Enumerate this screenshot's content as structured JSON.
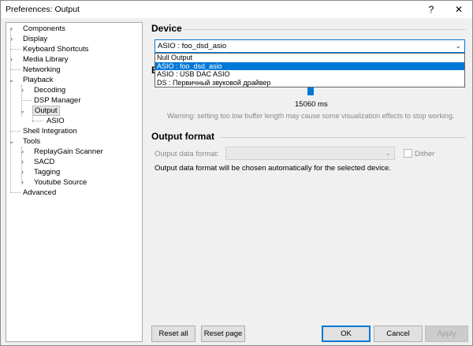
{
  "window": {
    "title": "Preferences: Output",
    "help_glyph": "?",
    "close_glyph": "✕"
  },
  "tree": {
    "items": [
      {
        "label": "Components",
        "expandable": true,
        "expanded": false
      },
      {
        "label": "Display",
        "expandable": true,
        "expanded": false
      },
      {
        "label": "Keyboard Shortcuts",
        "expandable": false
      },
      {
        "label": "Media Library",
        "expandable": true,
        "expanded": false
      },
      {
        "label": "Networking",
        "expandable": false
      },
      {
        "label": "Playback",
        "expandable": true,
        "expanded": true
      },
      {
        "label": "Decoding",
        "expandable": true,
        "expanded": false
      },
      {
        "label": "DSP Manager",
        "expandable": false
      },
      {
        "label": "Output",
        "expandable": true,
        "expanded": true,
        "selected": true
      },
      {
        "label": "ASIO",
        "expandable": false
      },
      {
        "label": "Shell Integration",
        "expandable": false
      },
      {
        "label": "Tools",
        "expandable": true,
        "expanded": true
      },
      {
        "label": "ReplayGain Scanner",
        "expandable": true,
        "expanded": false
      },
      {
        "label": "SACD",
        "expandable": true,
        "expanded": false
      },
      {
        "label": "Tagging",
        "expandable": true,
        "expanded": false
      },
      {
        "label": "Youtube Source",
        "expandable": true,
        "expanded": false
      },
      {
        "label": "Advanced",
        "expandable": false
      }
    ]
  },
  "device": {
    "section_title": "Device",
    "selected": "ASIO : foo_dsd_asio",
    "options": [
      "Null Output",
      "ASIO : foo_dsd_asio",
      "ASIO : USB DAC ASIO",
      "DS : Первичный звуковой драйвер"
    ],
    "highlighted_index": 1
  },
  "buffer": {
    "hidden_title_initial": "B",
    "value_label": "15060 ms",
    "warning": "Warning: setting too low buffer length may cause some visualization effects to stop working."
  },
  "output_format": {
    "section_title": "Output format",
    "data_format_label": "Output data format:",
    "data_format_value": "",
    "dither_label": "Dither",
    "dither_checked": false,
    "info": "Output data format will be chosen automatically for the selected device."
  },
  "buttons": {
    "reset_all": "Reset all",
    "reset_page": "Reset page",
    "ok": "OK",
    "cancel": "Cancel",
    "apply": "Apply"
  },
  "colors": {
    "accent": "#0078d7",
    "window_bg": "#f0f0f0"
  },
  "icons": {
    "chevron_right": "›",
    "chevron_down": "⌄",
    "dropdown_arrow": "⌄"
  }
}
